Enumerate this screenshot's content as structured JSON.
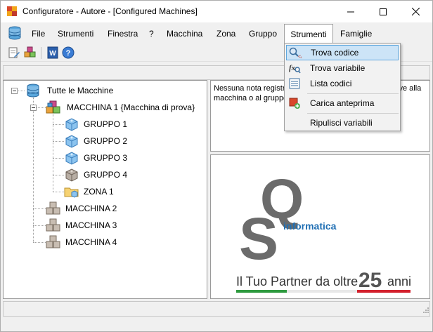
{
  "window": {
    "title": "Configuratore - Autore - [Configured Machines]",
    "buttons": {
      "minimize": "minimize",
      "maximize": "maximize",
      "close": "close"
    }
  },
  "menu": {
    "items": [
      "File",
      "Strumenti",
      "Finestra",
      "?",
      "Macchina",
      "Zona",
      "Gruppo",
      "Strumenti",
      "Famiglie"
    ],
    "open_index": 7
  },
  "toolbar": {
    "icons": [
      "edit-document-icon",
      "cubes-icon",
      "word-icon",
      "help-icon"
    ]
  },
  "dropdown": {
    "items": [
      {
        "label": "Trova codice",
        "icon": "find-code-icon",
        "highlighted": true
      },
      {
        "label": "Trova variabile",
        "icon": "find-variable-icon",
        "highlighted": false
      },
      {
        "label": "Lista codici",
        "icon": "code-list-icon",
        "highlighted": false
      },
      {
        "label": "Carica anteprima",
        "icon": "load-preview-icon",
        "highlighted": false
      },
      {
        "label": "Ripulisci variabili",
        "icon": "",
        "highlighted": false
      }
    ]
  },
  "tree": {
    "root": "Tutte le Macchine",
    "machine1": "MACCHINA 1 {Macchina di prova}",
    "groups": [
      "GRUPPO 1",
      "GRUPPO 2",
      "GRUPPO 3",
      "GRUPPO 4"
    ],
    "zone": "ZONA 1",
    "machines": [
      "MACCHINA 2",
      "MACCHINA 3",
      "MACCHINA 4"
    ]
  },
  "notes": {
    "line1": "Nessuna nota registra",
    "line1_end": "tive alla",
    "line2": "macchina o al gruppo"
  },
  "logo": {
    "letter_q": "Q",
    "letter_s": "S",
    "brand": "informatica",
    "tagline": "Il Tuo Partner da oltre",
    "years": "25",
    "tagline_end": "anni",
    "colors": {
      "green": "#2e9a3f",
      "red": "#d3212d",
      "blue": "#1f6fb4",
      "gray": "#6b6b6b"
    }
  }
}
